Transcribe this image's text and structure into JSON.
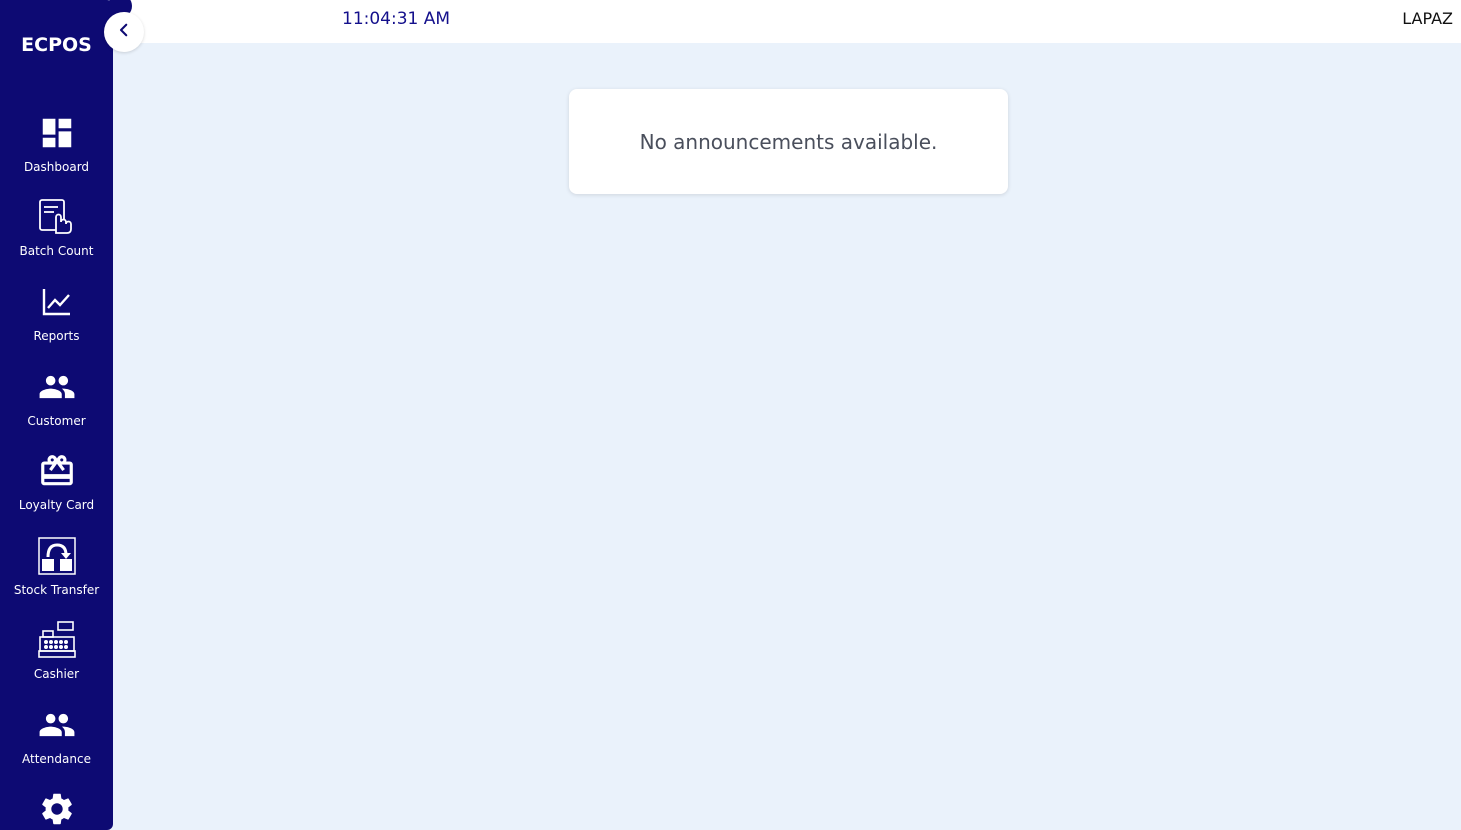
{
  "app": {
    "brand": "ECPOS"
  },
  "header": {
    "time": "11:04:31 AM",
    "store": "LAPAZ"
  },
  "sidebar": {
    "items": [
      {
        "label": "Dashboard",
        "icon": "dashboard-icon"
      },
      {
        "label": "Batch Count",
        "icon": "batch-count-icon"
      },
      {
        "label": "Reports",
        "icon": "chart-icon"
      },
      {
        "label": "Customer",
        "icon": "people-icon"
      },
      {
        "label": "Loyalty Card",
        "icon": "card-giftcard-icon"
      },
      {
        "label": "Stock Transfer",
        "icon": "stock-transfer-icon"
      },
      {
        "label": "Cashier",
        "icon": "cash-register-icon"
      },
      {
        "label": "Attendance",
        "icon": "people-icon"
      },
      {
        "label": "",
        "icon": "gear-icon"
      }
    ]
  },
  "main": {
    "announcement_text": "No announcements available."
  },
  "colors": {
    "sidebar_bg": "#0d0a73",
    "page_bg": "#eaf2fb",
    "clock_color": "#14108c"
  }
}
